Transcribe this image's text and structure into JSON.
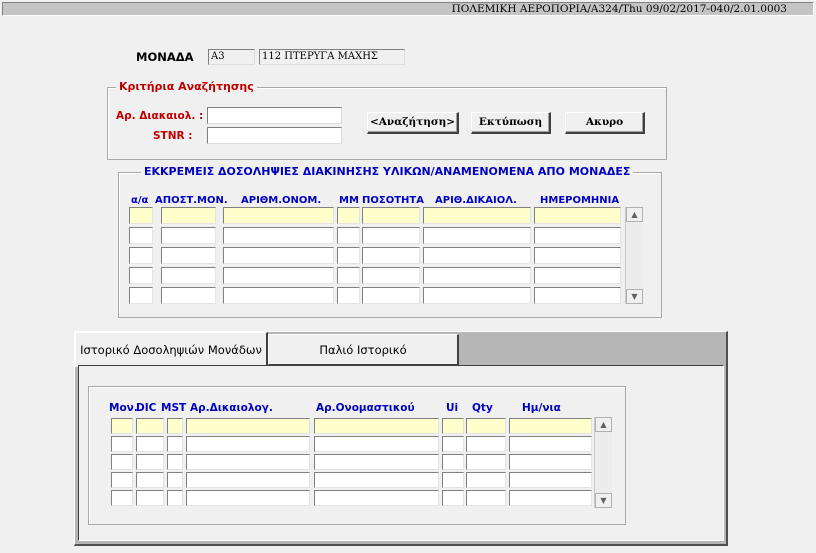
{
  "status_bar": {
    "text": "ΠΟΛΕΜΙΚΗ ΑΕΡΟΠΟΡΙΑ/A324/Thu 09/02/2017-040/2.01.0003"
  },
  "unit": {
    "label": "ΜΟΝΑΔΑ",
    "code": "A3",
    "name": "112 ΠΤΕΡΥΓΑ ΜΑΧΗΣ"
  },
  "search": {
    "title": "Κριτήρια Αναζήτησης",
    "justification_label": "Αρ. Διακαιολ. :",
    "justification_value": "",
    "stnr_label": "STNR :",
    "stnr_value": "",
    "search_button": "<Αναζήτηση>",
    "print_button": "Εκτύπωση",
    "cancel_button": "Ακυρο"
  },
  "pending": {
    "title": "ΕΚΚΡΕΜΕΙΣ ΔΟΣΟΛΗΨΙΕΣ ΔΙΑΚΙΝΗΣΗΣ ΥΛΙΚΩΝ/ΑΝΑΜΕΝΟΜΕΝΑ ΑΠΟ ΜΟΝΑΔΕΣ",
    "columns": [
      "α/α",
      "ΑΠΟΣΤ.ΜΟΝ.",
      "ΑΡΙΘΜ.ΟΝΟΜ.",
      "ΜΜ",
      "ΠΟΣΟΤΗΤΑ",
      "ΑΡΙΘ.ΔΙΚΑΙΟΛ.",
      "ΗΜΕΡΟΜΗΝΙΑ"
    ]
  },
  "tabs": [
    {
      "label": "Ιστορικό Δοσοληψιών Μονάδων",
      "active": true
    },
    {
      "label": "Παλιό Ιστορικό",
      "active": false
    }
  ],
  "history": {
    "columns": [
      "Μον.",
      "DIC",
      "MST",
      "Αρ.Δικαιολογ.",
      "Αρ.Ονομαστικού",
      "Ui",
      "Qty",
      "Ημ/νια"
    ]
  },
  "icons": {
    "scroll_up": "▲",
    "scroll_down": "▼"
  }
}
